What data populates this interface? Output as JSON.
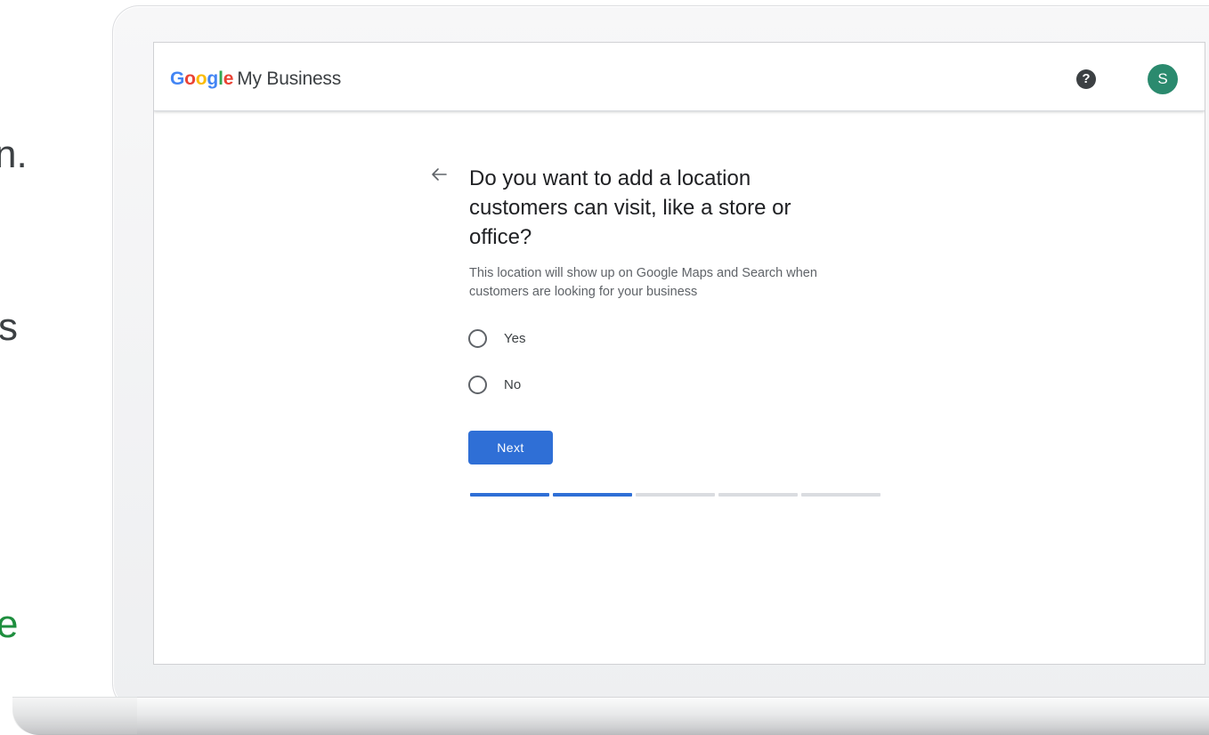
{
  "background_text": {
    "fragment_1": "n.",
    "fragment_2": "s",
    "fragment_3": "e"
  },
  "header": {
    "logo": {
      "google_letters": [
        "G",
        "o",
        "o",
        "g",
        "l",
        "e"
      ],
      "product": "My Business"
    },
    "help_icon": "?",
    "avatar_letter": "S"
  },
  "colors": {
    "primary": "#2f6fd6",
    "avatar": "#2b8a6e",
    "text_primary": "#202124",
    "text_secondary": "#5f6368",
    "progress_inactive": "#dadce0"
  },
  "icons": {
    "back": "back-arrow-icon",
    "help": "help-icon",
    "radio": "radio-unchecked-icon"
  },
  "form": {
    "question": "Do you want to add a location customers can visit, like a store or office?",
    "description": "This location will show up on Google Maps and Search when customers are looking for your business",
    "options": [
      {
        "label": "Yes",
        "selected": false
      },
      {
        "label": "No",
        "selected": false
      }
    ],
    "next_label": "Next"
  },
  "progress": {
    "total_steps": 5,
    "completed_steps": 2
  }
}
